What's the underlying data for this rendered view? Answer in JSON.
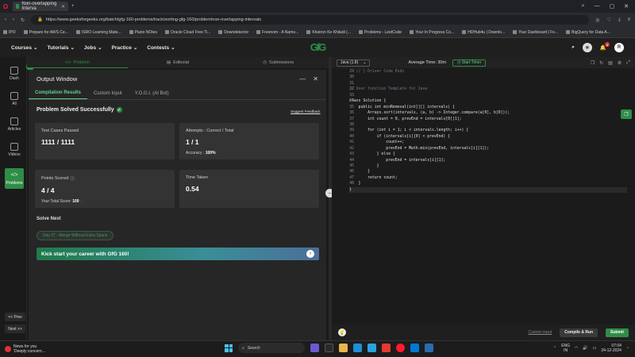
{
  "browser": {
    "tab_title": "Non-overlapping Interva",
    "new_tab": "+",
    "url": "https://www.geeksforgeeks.org/batch/gfg-160-problems/track/sorting-gfg-160/problem/non-overlapping-intervals",
    "bookmarks": [
      "IPO",
      "Prepare for AWS Ce...",
      "ISRO Learning Mate...",
      "Piano NOtes",
      "Oracle Cloud Free Ti...",
      "Downdetector",
      "Freenom - A Name...",
      "Khatron Ke Khiladi (...",
      "Problems - LeetCode",
      "Your In Progress Co...",
      "HDHub4u | Downlo...",
      "Your Dashboard | Fo...",
      "BigQuery for Data A..."
    ]
  },
  "nav": {
    "items": [
      "Courses",
      "Tutorials",
      "Jobs",
      "Practice",
      "Contests"
    ],
    "logo": "GfG",
    "notif_count": "2",
    "avatar": "R"
  },
  "panel_tabs": [
    "Problem",
    "Editorial",
    "Submissions"
  ],
  "sidebar": {
    "items": [
      "Dash",
      "All",
      "Articles",
      "Videos",
      "Problems"
    ],
    "prev": "<< Prev",
    "next": "Next >>"
  },
  "output": {
    "title": "Output Window",
    "subtabs": [
      "Compilation Results",
      "Custom Input",
      "Y.O.G.I. (AI Bot)"
    ],
    "status": "Problem Solved Successfully",
    "feedback": "Suggest Feedback",
    "cards": {
      "test_cases_label": "Test Cases Passed",
      "test_cases_value": "1111 / 1111",
      "attempts_label": "Attempts : Correct / Total",
      "attempts_value": "1 / 1",
      "accuracy_label": "Accuracy :",
      "accuracy_value": "100%",
      "points_label": "Points Scored",
      "points_value": "4 / 4",
      "total_score_label": "Your Total Score:",
      "total_score_value": "100",
      "time_label": "Time Taken",
      "time_value": "0.54"
    },
    "solve_next_label": "Solve Next",
    "next_problem": "Day 27 - Merge Without Extra Space",
    "banner": "Kick start your career with GfG 160!"
  },
  "editor": {
    "language": "Java (1.8)",
    "avg_time": "Average Time: 30m",
    "timer": "Start Timer",
    "line_numbers": [
      "29",
      "30",
      "31",
      "32",
      "33",
      "34",
      "35",
      "36",
      "37",
      "38",
      "39",
      "40",
      "41",
      "42",
      "43",
      "44",
      "45",
      "46",
      "47",
      "48",
      "49"
    ],
    "code_lines": [
      "   // } Driver Code Ends",
      "",
      "",
      "// User function Template for Java",
      "",
      "class Solution {",
      "    public int minRemoval(int[][] intervals) {",
      "        Arrays.sort(intervals, (a, b) -> Integer.compare(a[0], b[0]));",
      "        int count = 0, prevEnd = intervals[0][1];",
      "",
      "        for (int i = 1; i < intervals.length; i++) {",
      "            if (intervals[i][0] < prevEnd) {",
      "                count++;",
      "                prevEnd = Math.min(prevEnd, intervals[i][1]);",
      "            } else {",
      "                prevEnd = intervals[i][1];",
      "            }",
      "        }",
      "        return count;",
      "    }",
      "}"
    ],
    "custom_input": "Custom Input",
    "compile_run": "Compile & Run",
    "submit": "Submit"
  },
  "taskbar": {
    "news_title": "News for you",
    "news_sub": "'Deeply concern...",
    "search": "Search",
    "lang_top": "ENG",
    "lang_bottom": "IN",
    "time": "07:04",
    "date": "24-12-2024"
  },
  "colors": {
    "accent": "#2f8d46"
  }
}
